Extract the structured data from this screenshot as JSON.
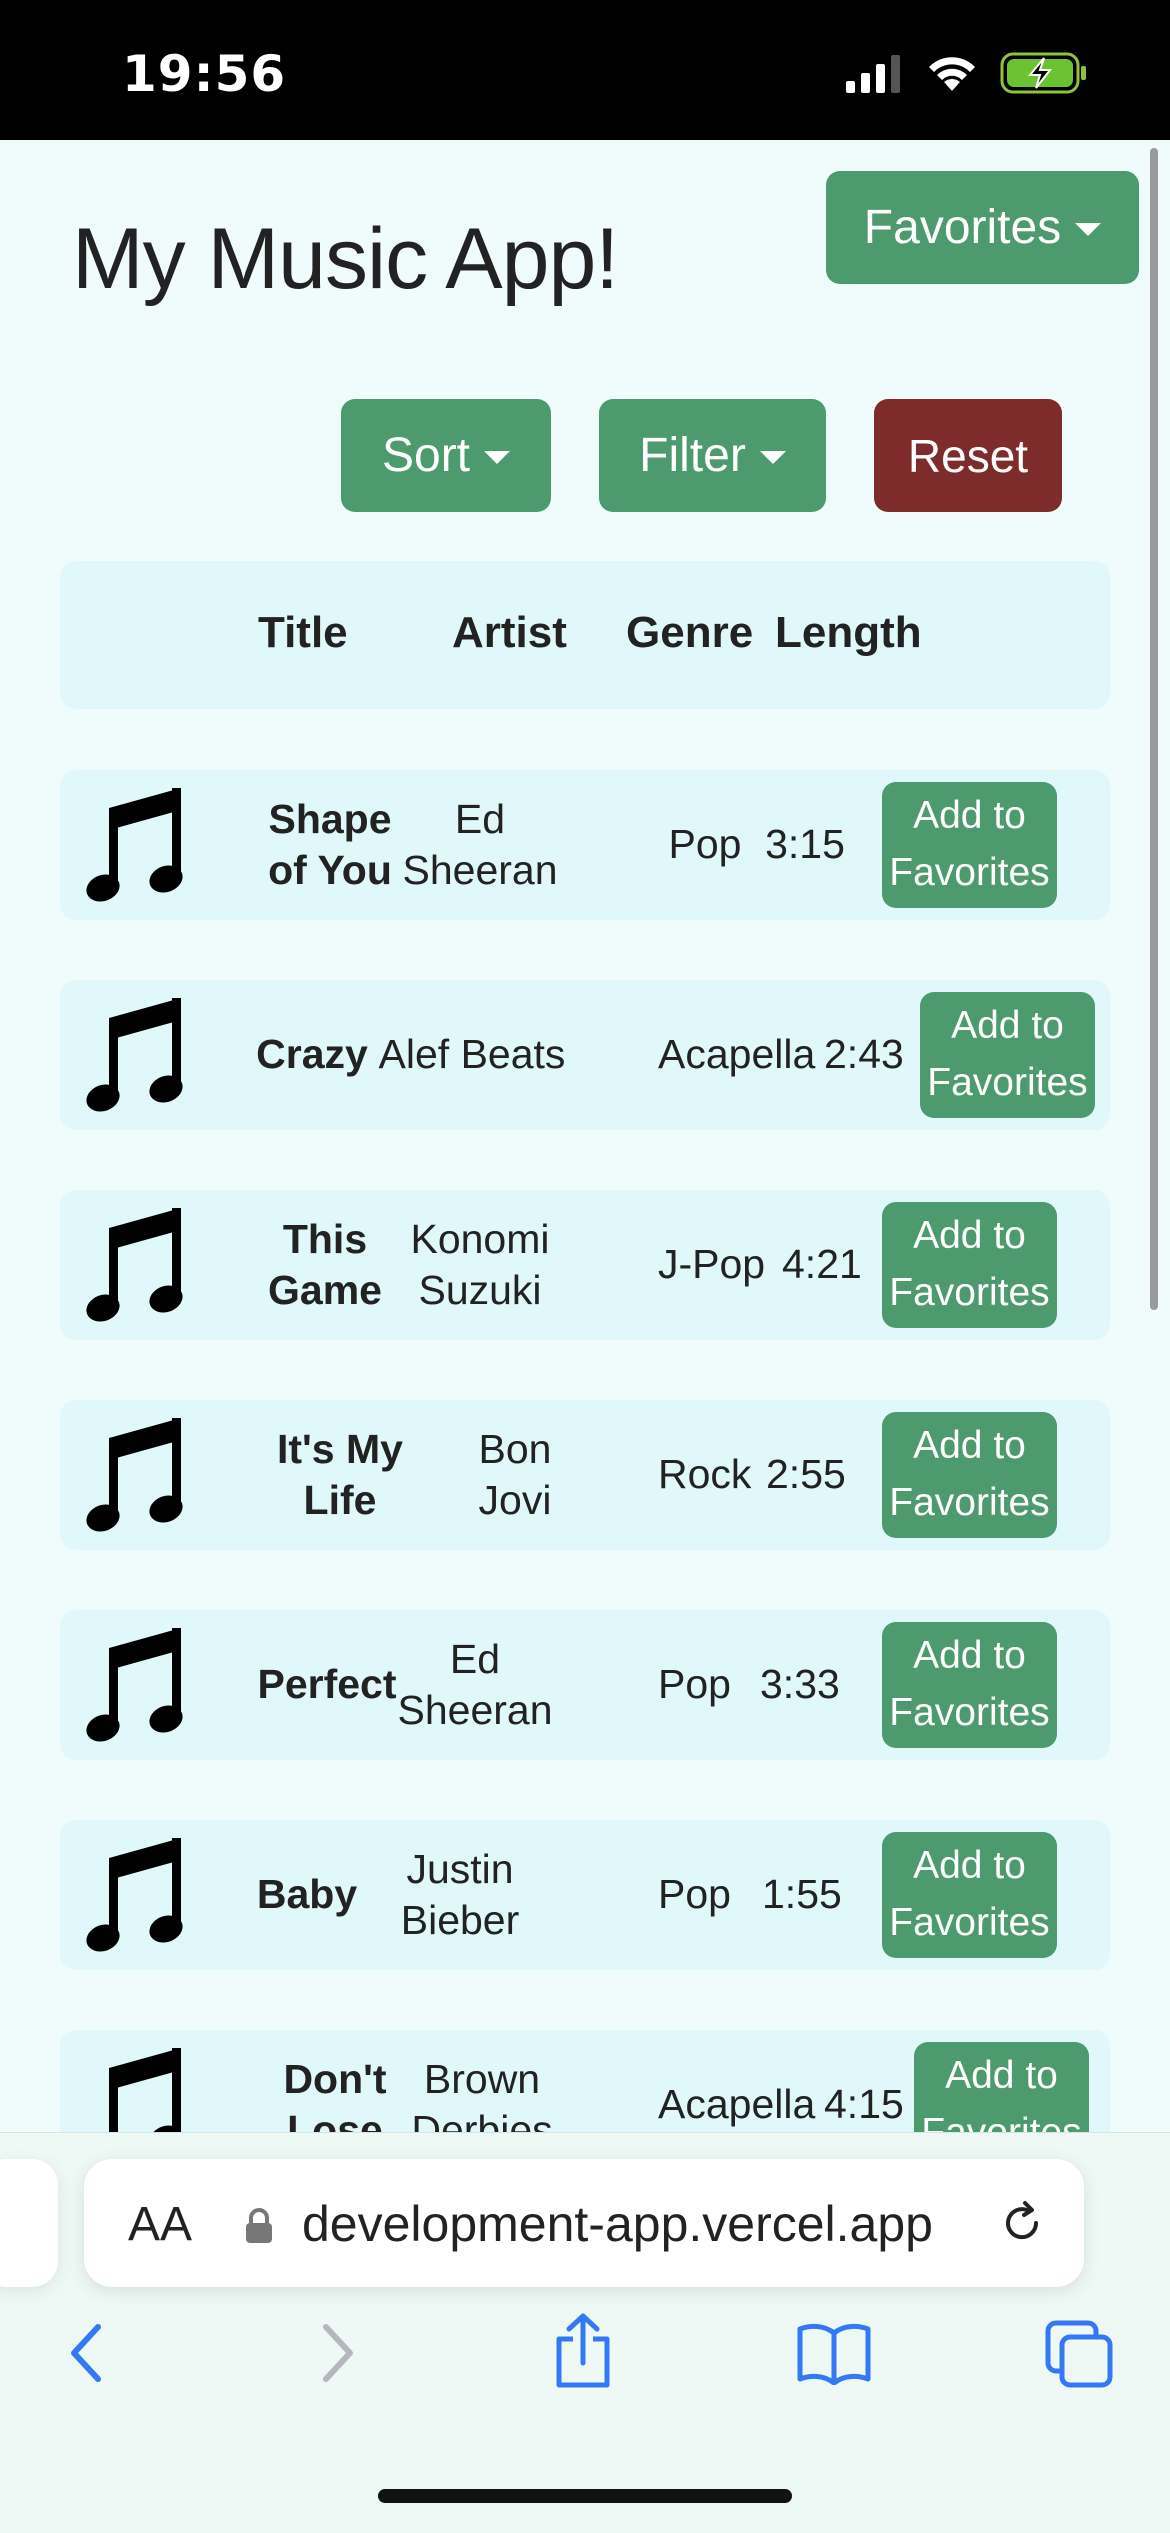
{
  "status_bar": {
    "time": "19:56"
  },
  "app": {
    "title": "My Music App!",
    "favorites_label": "Favorites",
    "sort_label": "Sort",
    "filter_label": "Filter",
    "reset_label": "Reset"
  },
  "table": {
    "headers": {
      "title": "Title",
      "artist": "Artist",
      "genre": "Genre",
      "length": "Length"
    },
    "add_label_line1": "Add to",
    "add_label_line2": "Favorites",
    "songs": [
      {
        "title": "Shape of You",
        "artist": "Ed Sheeran",
        "genre": "Pop",
        "length": "3:15"
      },
      {
        "title": "Crazy",
        "artist": "Alef Beats",
        "genre": "Acapella",
        "length": "2:43"
      },
      {
        "title": "This Game",
        "artist": "Konomi Suzuki",
        "genre": "J-Pop",
        "length": "4:21"
      },
      {
        "title": "It's My Life",
        "artist": "Bon Jovi",
        "genre": "Rock",
        "length": "2:55"
      },
      {
        "title": "Perfect",
        "artist": "Ed Sheeran",
        "genre": "Pop",
        "length": "3:33"
      },
      {
        "title": "Baby",
        "artist": "Justin Bieber",
        "genre": "Pop",
        "length": "1:55"
      },
      {
        "title": "Don't Lose",
        "artist": "Brown Derbies",
        "genre": "Acapella",
        "length": "4:15"
      }
    ]
  },
  "browser": {
    "text_size_label": "AA",
    "url": "development-app.vercel.app"
  },
  "colors": {
    "accent_green": "#4d9a6f",
    "reset_red": "#7d2b2b",
    "row_background": "#e1f8fa",
    "page_background": "#f0fbfc",
    "safari_blue": "#3478f6"
  },
  "icons": {
    "song": "music-note-icon",
    "cellular": "cellular-signal-icon",
    "wifi": "wifi-icon",
    "battery": "battery-charging-icon",
    "lock": "lock-icon",
    "reload": "reload-icon",
    "back": "back-arrow-icon",
    "forward": "forward-arrow-icon",
    "share": "share-icon",
    "bookmarks": "bookmarks-icon",
    "tabs": "tabs-icon"
  }
}
